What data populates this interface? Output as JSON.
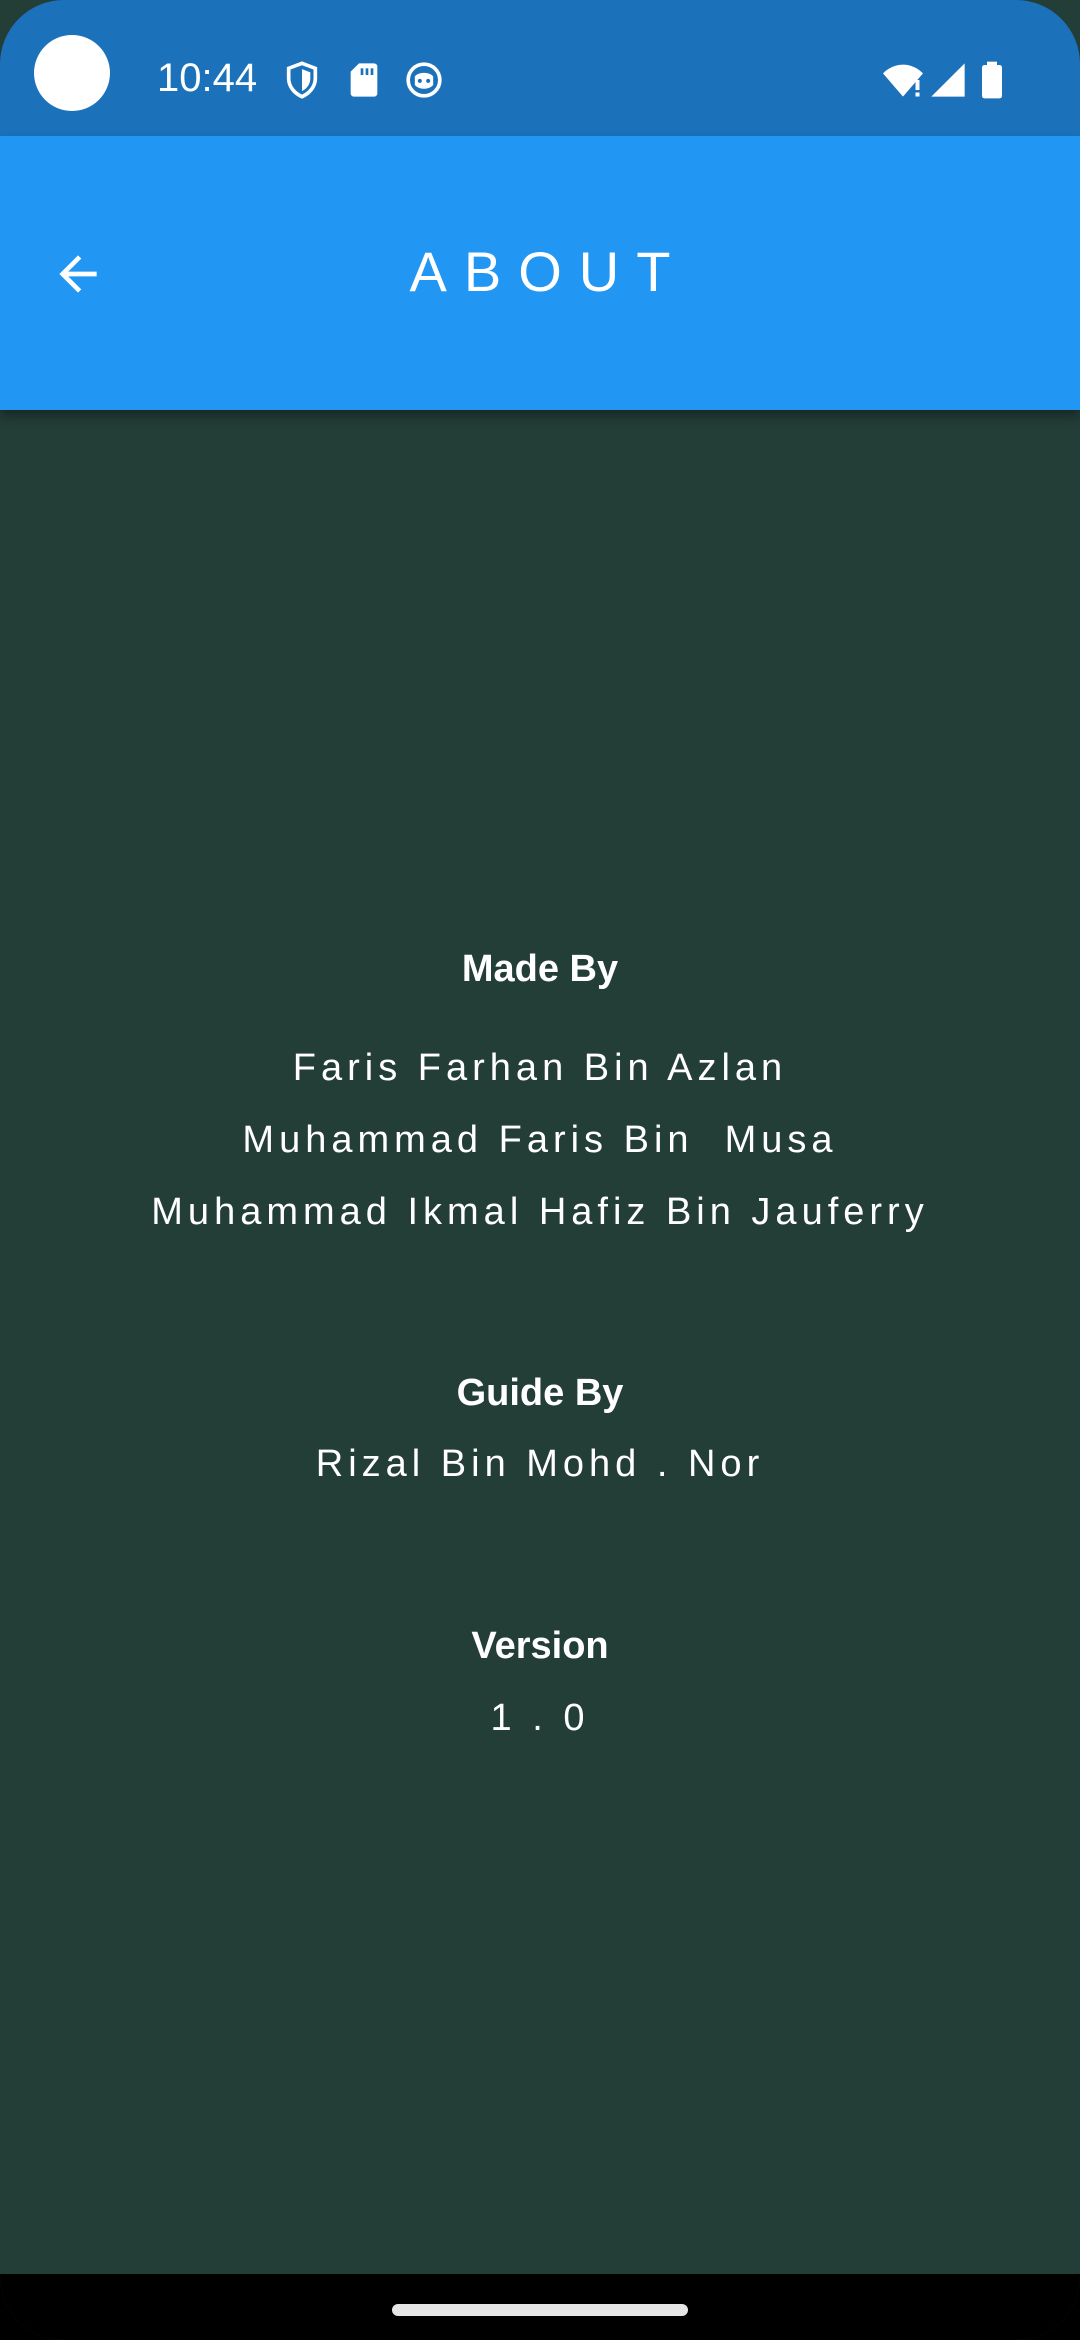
{
  "status_bar": {
    "time": "10:44",
    "icons": [
      "shield-icon",
      "sd-card-icon",
      "face-icon",
      "wifi-alert-icon",
      "cell-signal-icon",
      "battery-icon"
    ]
  },
  "app_bar": {
    "title": "ABOUT",
    "back_icon": "arrow-back-icon"
  },
  "sections": {
    "made_by": {
      "heading": "Made By",
      "names": [
        "Faris Farhan Bin Azlan",
        "Muhammad Faris Bin  Musa",
        "Muhammad Ikmal Hafiz Bin Jauferry"
      ]
    },
    "guide_by": {
      "heading": "Guide By",
      "name": "Rizal Bin Mohd . Nor"
    },
    "version": {
      "heading": "Version",
      "value": "1 . 0"
    }
  },
  "colors": {
    "status_bar": "#1b72bb",
    "app_bar": "#2196f3",
    "background": "#233d37",
    "text": "#ffffff"
  }
}
